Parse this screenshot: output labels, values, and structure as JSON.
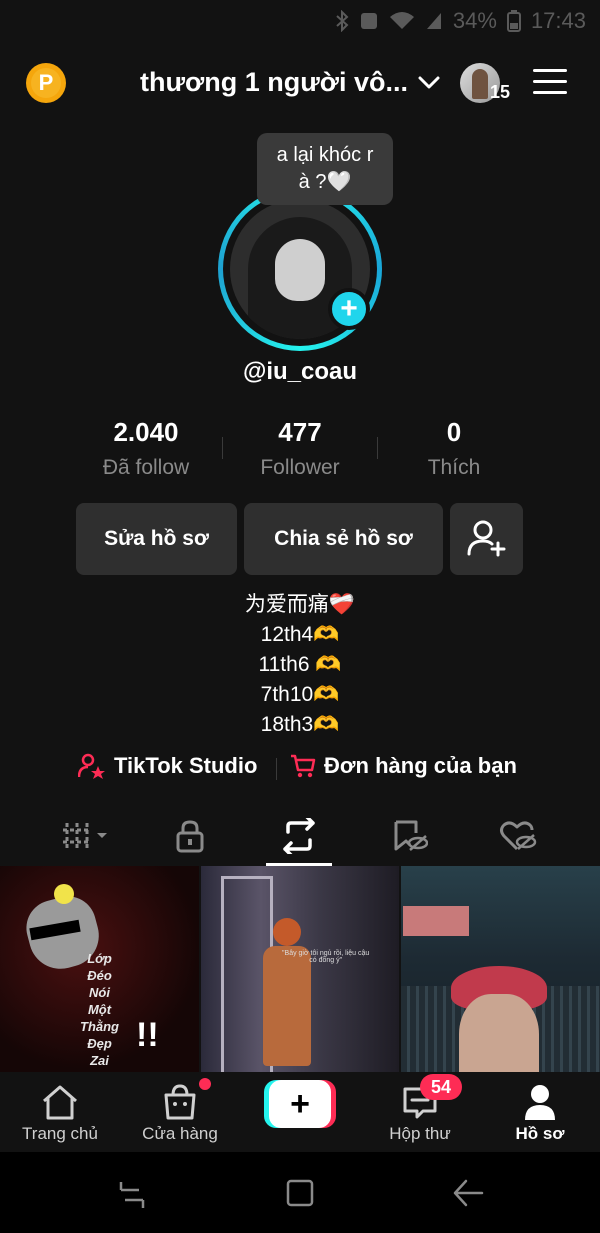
{
  "status_bar": {
    "battery": "34%",
    "time": "17:43"
  },
  "header": {
    "coin_label": "P",
    "account_name": "thương 1 người vô...",
    "switcher_badge": "15"
  },
  "profile": {
    "bubble_text_line1": "a lại khóc r",
    "bubble_text_line2": "à ?🤍",
    "username": "@iu_coau",
    "plus_label": "+"
  },
  "stats": [
    {
      "value": "2.040",
      "label": "Đã follow"
    },
    {
      "value": "477",
      "label": "Follower"
    },
    {
      "value": "0",
      "label": "Thích"
    }
  ],
  "actions": {
    "edit": "Sửa hồ sơ",
    "share": "Chia sẻ hồ sơ"
  },
  "bio": [
    "为爱而痛❤️‍🩹",
    "12th4🫶",
    "11th6 🫶",
    "7th10🫶",
    "18th3🫶"
  ],
  "links": {
    "studio": "TikTok Studio",
    "orders": "Đơn hàng của bạn"
  },
  "tabs": [
    "videos",
    "private",
    "reposts",
    "favorites",
    "liked"
  ],
  "active_tab": "reposts",
  "thumbnails": {
    "t1_text": "Lớp\nĐéo\nNói\nMột\nThằng\nĐẹp\nZai",
    "t2_caption": "\"Bây giờ tôi ngủ rồi, liệu cậu có đồng ý\""
  },
  "bottom_nav": {
    "home": "Trang chủ",
    "shop": "Cửa hàng",
    "create": "+",
    "inbox": "Hộp thư",
    "inbox_count": "54",
    "profile": "Hồ sơ"
  },
  "colors": {
    "accent_cyan": "#25f4ee",
    "accent_red": "#fe2c55",
    "background": "#121212"
  }
}
